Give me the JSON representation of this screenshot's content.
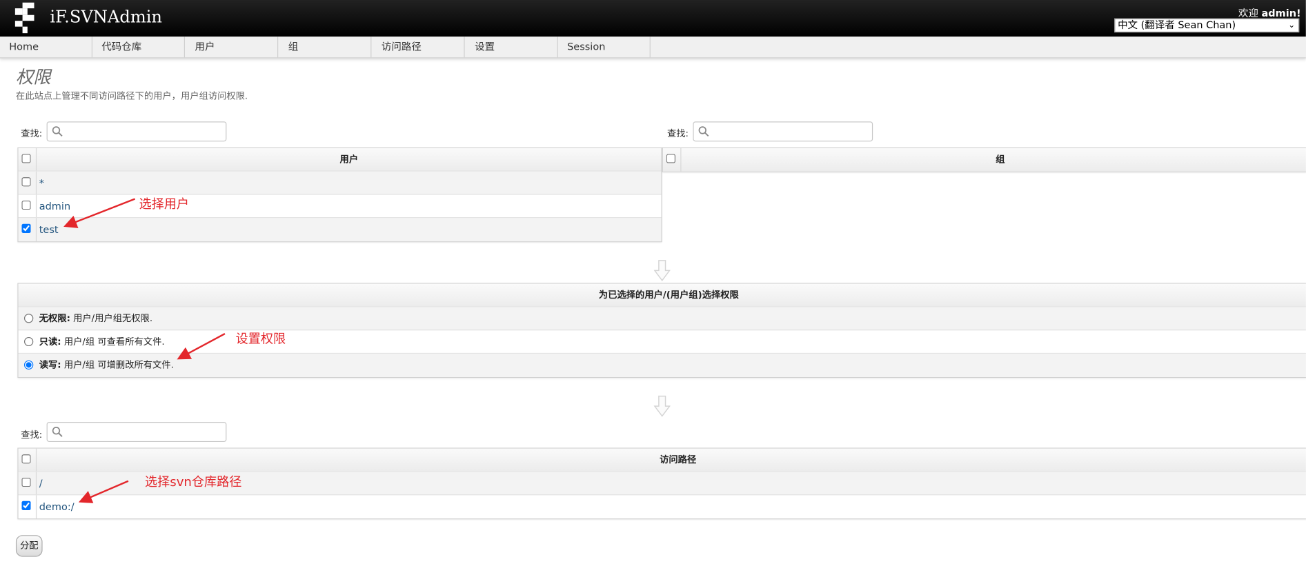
{
  "header": {
    "app_title": "iF.SVNAdmin",
    "welcome_prefix": "欢迎",
    "welcome_user": "admin!",
    "language_select": "中文 (翻译者 Sean Chan)"
  },
  "nav": {
    "items": [
      {
        "label": "Home"
      },
      {
        "label": "代码仓库"
      },
      {
        "label": "用户"
      },
      {
        "label": "组"
      },
      {
        "label": "访问路径"
      },
      {
        "label": "设置"
      },
      {
        "label": "Session"
      }
    ]
  },
  "page": {
    "title": "权限",
    "description": "在此站点上管理不同访问路径下的用户，用户组访问权限."
  },
  "search": {
    "label": "查找:",
    "placeholder": ""
  },
  "users_table": {
    "header": "用户",
    "rows": [
      {
        "name": "*",
        "checked": false
      },
      {
        "name": "admin",
        "checked": false
      },
      {
        "name": "test",
        "checked": true
      }
    ]
  },
  "groups_table": {
    "header": "组",
    "rows": []
  },
  "permissions": {
    "header": "为已选择的用户/(用户组)选择权限",
    "options": [
      {
        "title": "无权限:",
        "desc": "用户/用户组无权限.",
        "selected": false
      },
      {
        "title": "只读:",
        "desc": "用户/组 可查看所有文件.",
        "selected": false
      },
      {
        "title": "读写:",
        "desc": "用户/组 可增删改所有文件.",
        "selected": true
      }
    ]
  },
  "paths_table": {
    "header": "访问路径",
    "rows": [
      {
        "name": "/",
        "checked": false
      },
      {
        "name": "demo:/",
        "checked": true
      }
    ]
  },
  "annotations": {
    "select_user": "选择用户",
    "set_permission": "设置权限",
    "select_repo_path": "选择svn仓库路径",
    "color": "#e3262b"
  },
  "actions": {
    "assign_label": "分配"
  },
  "colors": {
    "link": "#23557e",
    "topbar": "#000000",
    "navbar": "#f0f0f0"
  }
}
